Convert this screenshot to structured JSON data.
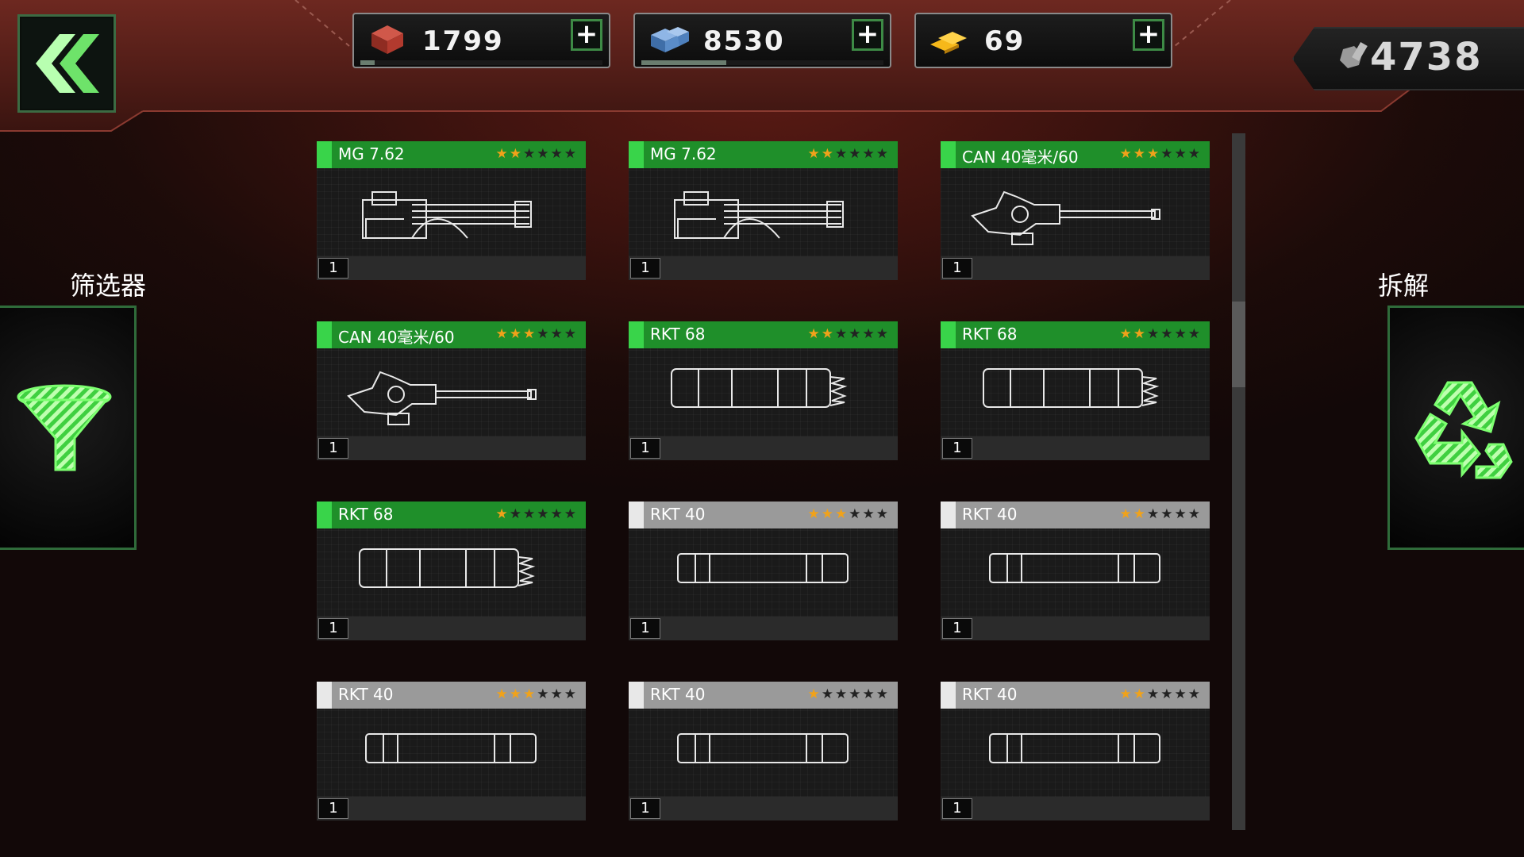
{
  "resources": [
    {
      "name": "supplies",
      "value": "1799",
      "icon": "red-crate-icon",
      "fill": 0.06
    },
    {
      "name": "materials",
      "value": "8530",
      "icon": "blue-cubes-icon",
      "fill": 0.35
    },
    {
      "name": "gold",
      "value": "69",
      "icon": "gold-bars-icon",
      "fill": 0
    }
  ],
  "parts": {
    "value": "4738",
    "icon": "nut-bolt-icon"
  },
  "filter": {
    "label": "筛选器",
    "icon": "funnel-icon"
  },
  "dismantle": {
    "label": "拆解",
    "icon": "recycle-icon"
  },
  "items": [
    {
      "name": "MG 7.62",
      "stars": 2,
      "count": "1",
      "rarity": "green",
      "kind": "mg"
    },
    {
      "name": "MG 7.62",
      "stars": 2,
      "count": "1",
      "rarity": "green",
      "kind": "mg"
    },
    {
      "name": "CAN 40毫米/60",
      "stars": 3,
      "count": "1",
      "rarity": "green",
      "kind": "can"
    },
    {
      "name": "CAN 40毫米/60",
      "stars": 3,
      "count": "1",
      "rarity": "green",
      "kind": "can"
    },
    {
      "name": "RKT 68",
      "stars": 2,
      "count": "1",
      "rarity": "green",
      "kind": "rkt68"
    },
    {
      "name": "RKT 68",
      "stars": 2,
      "count": "1",
      "rarity": "green",
      "kind": "rkt68"
    },
    {
      "name": "RKT 68",
      "stars": 1,
      "count": "1",
      "rarity": "green",
      "kind": "rkt68"
    },
    {
      "name": "RKT 40",
      "stars": 3,
      "count": "1",
      "rarity": "grey",
      "kind": "rkt40"
    },
    {
      "name": "RKT 40",
      "stars": 2,
      "count": "1",
      "rarity": "grey",
      "kind": "rkt40"
    },
    {
      "name": "RKT 40",
      "stars": 3,
      "count": "1",
      "rarity": "grey",
      "kind": "rkt40"
    },
    {
      "name": "RKT 40",
      "stars": 1,
      "count": "1",
      "rarity": "grey",
      "kind": "rkt40"
    },
    {
      "name": "RKT 40",
      "stars": 2,
      "count": "1",
      "rarity": "grey",
      "kind": "rkt40"
    }
  ],
  "max_stars": 6,
  "colors": {
    "green": "#1f8f2a",
    "grey": "#9a9a9a",
    "star": "#f0a21a"
  }
}
